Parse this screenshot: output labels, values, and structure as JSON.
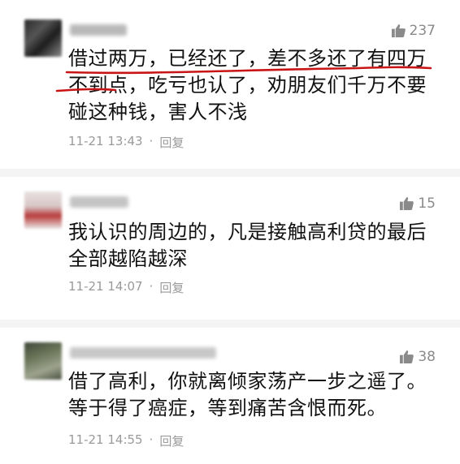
{
  "comments": [
    {
      "likes": "237",
      "text": "借过两万，已经还了，差不多还了有四万不到点，吃亏也认了，劝朋友们千万不要碰这种钱，害人不浅",
      "time": "11-21 13:43",
      "separator": "·",
      "reply": "回复"
    },
    {
      "likes": "15",
      "text": "我认识的周边的，凡是接触高利贷的最后全部越陷越深",
      "time": "11-21 14:07",
      "separator": "·",
      "reply": "回复"
    },
    {
      "likes": "38",
      "text": "借了高利，你就离倾家荡产一步之遥了。等于得了癌症，等到痛苦含恨而死。",
      "time": "11-21 14:55",
      "separator": "·",
      "reply": "回复"
    }
  ],
  "colors": {
    "meta_text": "#9a9a9a",
    "annotation_red": "#c81414",
    "divider": "#f4f4f4"
  },
  "icons": {
    "like": "thumb-up-icon"
  }
}
